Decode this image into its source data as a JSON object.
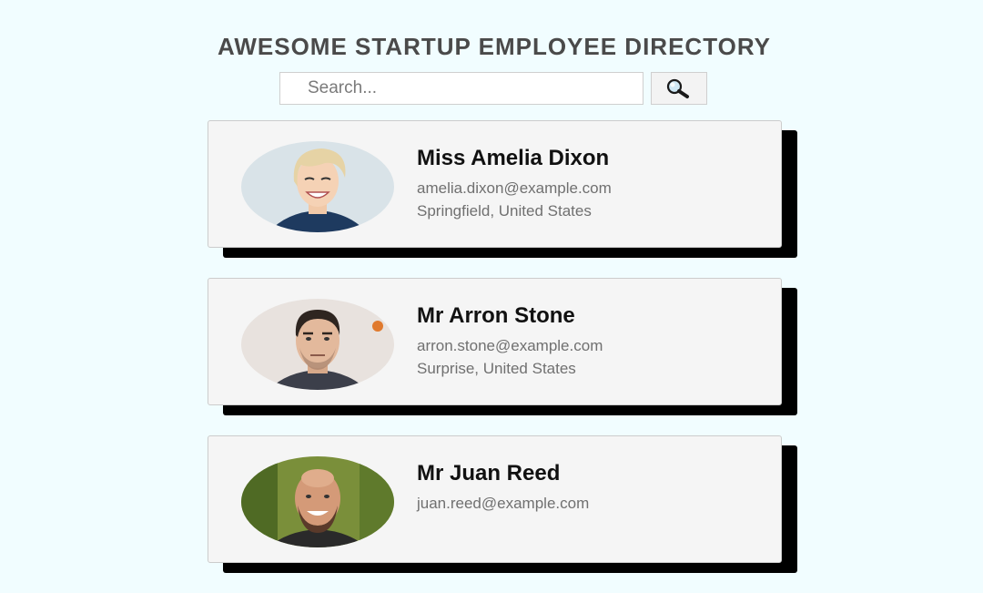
{
  "header": {
    "title": "AWESOME STARTUP EMPLOYEE DIRECTORY"
  },
  "search": {
    "placeholder": "Search...",
    "value": "",
    "button_icon": "magnifier-icon"
  },
  "employees": [
    {
      "name": "Miss Amelia Dixon",
      "email": "amelia.dixon@example.com",
      "location": "Springfield, United States"
    },
    {
      "name": "Mr Arron Stone",
      "email": "arron.stone@example.com",
      "location": "Surprise, United States"
    },
    {
      "name": "Mr Juan Reed",
      "email": "juan.reed@example.com",
      "location": ""
    }
  ],
  "colors": {
    "page_background": "#f1fdff",
    "card_background": "#f5f5f5",
    "card_shadow": "#000000"
  }
}
